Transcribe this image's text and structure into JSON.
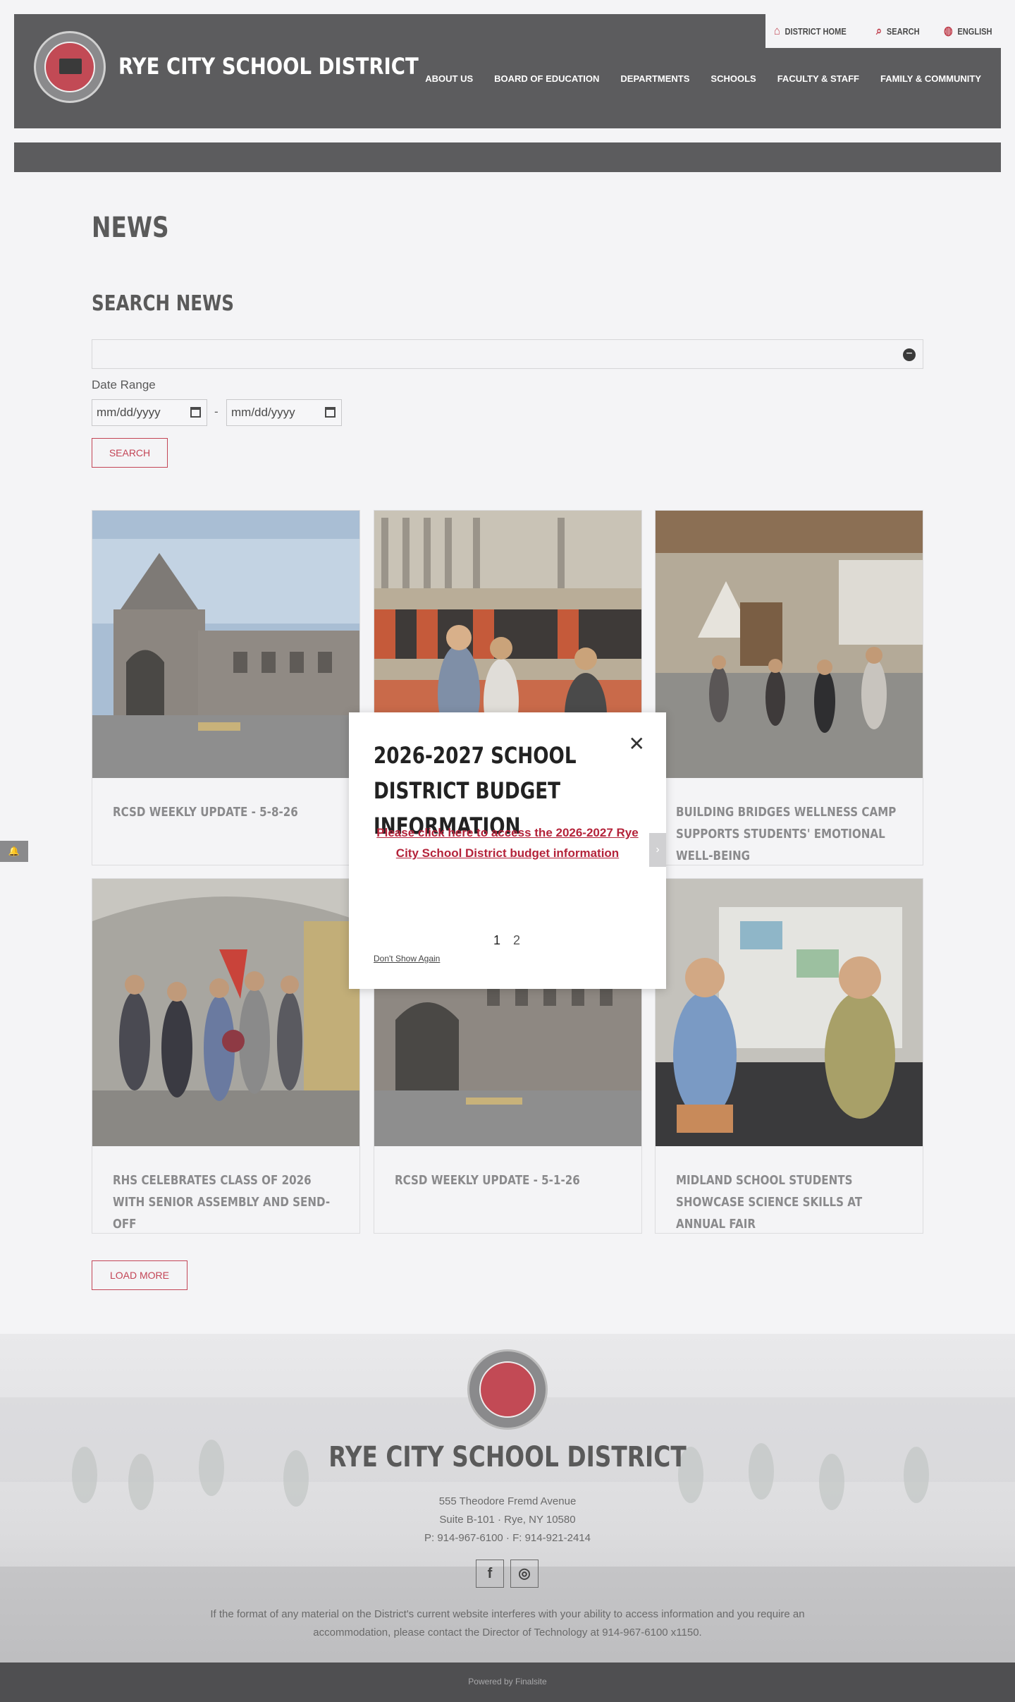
{
  "header": {
    "site_title": "RYE CITY SCHOOL DISTRICT",
    "utility": [
      {
        "label": "DISTRICT HOME",
        "icon": "home-icon"
      },
      {
        "label": "SEARCH",
        "icon": "search-icon"
      },
      {
        "label": "ENGLISH",
        "icon": "globe-icon"
      }
    ],
    "nav": [
      "ABOUT US",
      "BOARD OF EDUCATION",
      "DEPARTMENTS",
      "SCHOOLS",
      "FACULTY & STAFF",
      "FAMILY & COMMUNITY"
    ]
  },
  "main": {
    "page_title": "NEWS",
    "search_title": "SEARCH NEWS",
    "search_value": "",
    "date_range_label": "Date Range",
    "date_from_placeholder": "mm/dd/yyyy",
    "date_to_placeholder": "mm/dd/yyyy",
    "date_separator": "-",
    "search_button": "SEARCH",
    "load_more": "LOAD MORE"
  },
  "news": [
    {
      "title": "RCSD WEEKLY UPDATE - 5-8-26"
    },
    {
      "title": ""
    },
    {
      "title": "BUILDING BRIDGES WELLNESS CAMP SUPPORTS STUDENTS' EMOTIONAL WELL-BEING"
    },
    {
      "title": "RHS CELEBRATES CLASS OF 2026 WITH SENIOR ASSEMBLY AND SEND-OFF"
    },
    {
      "title": "RCSD WEEKLY UPDATE - 5-1-26"
    },
    {
      "title": "MIDLAND SCHOOL STUDENTS SHOWCASE SCIENCE SKILLS AT ANNUAL FAIR"
    }
  ],
  "modal": {
    "title": "2026-2027 SCHOOL DISTRICT BUDGET INFORMATION",
    "link": "Please click here to access the 2026-2027 Rye City School District budget information",
    "pages": [
      "1",
      "2"
    ],
    "dont_show": "Don't Show Again"
  },
  "footer": {
    "title": "RYE CITY SCHOOL DISTRICT",
    "address1": "555 Theodore Fremd Avenue",
    "address2": "Suite B-101 · Rye, NY 10580",
    "phone_line": "P: 914-967-6100 · F: 914-921-2414",
    "access": "If the format of any material on the District's current website interferes with your ability to access information and you require an accommodation, please contact the Director of Technology at 914-967-6100 x1150.",
    "powered": "Powered by Finalsite",
    "social": [
      {
        "icon": "facebook-icon",
        "glyph": "f"
      },
      {
        "icon": "instagram-icon",
        "glyph": "◎"
      }
    ]
  },
  "colors": {
    "accent": "#c34556",
    "header_bg": "#5c5c5e",
    "link_red": "#b4233a"
  }
}
